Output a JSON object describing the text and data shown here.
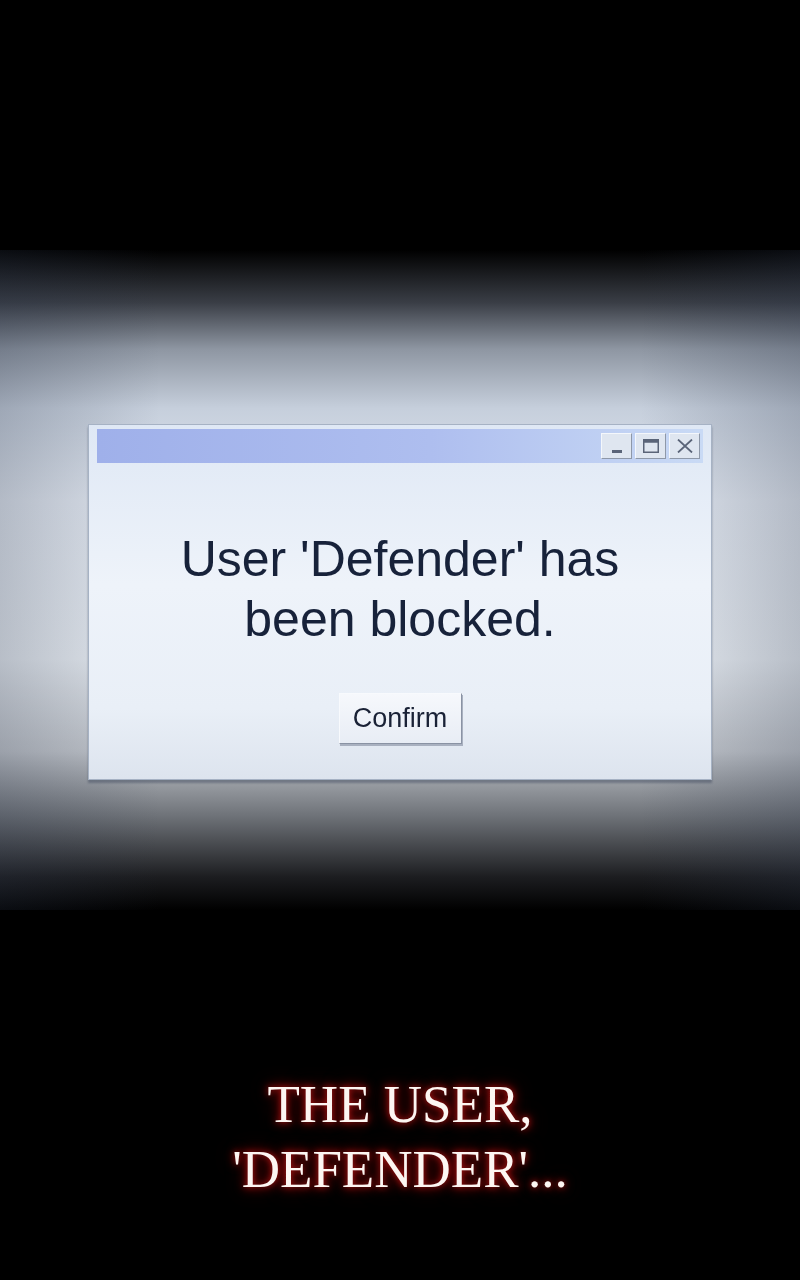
{
  "dialog": {
    "window_controls": [
      {
        "kind": "minimize"
      },
      {
        "kind": "maximize"
      },
      {
        "kind": "close"
      }
    ],
    "message": "User 'Defender' has been blocked.",
    "buttons": [
      "Confirm"
    ]
  },
  "caption": "THE USER, 'DEFENDER'..."
}
